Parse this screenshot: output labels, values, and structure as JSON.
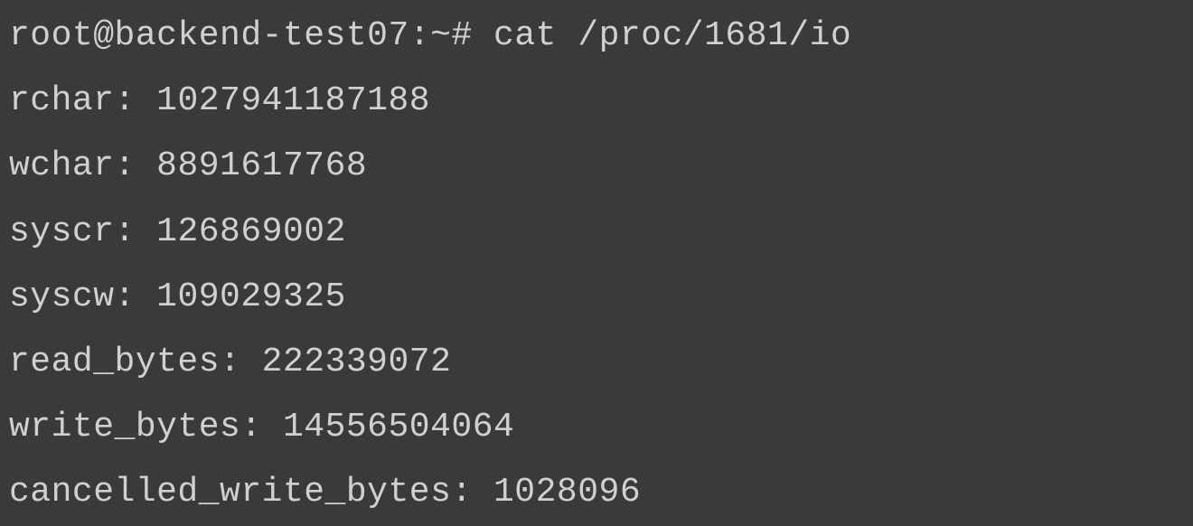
{
  "prompt": {
    "user": "root",
    "host": "backend-test07",
    "path": "~",
    "symbol": "#",
    "command": "cat /proc/1681/io"
  },
  "output": {
    "rchar": {
      "label": "rchar:",
      "value": "1027941187188"
    },
    "wchar": {
      "label": "wchar:",
      "value": "8891617768"
    },
    "syscr": {
      "label": "syscr:",
      "value": "126869002"
    },
    "syscw": {
      "label": "syscw:",
      "value": "109029325"
    },
    "read_bytes": {
      "label": "read_bytes:",
      "value": "222339072"
    },
    "write_bytes": {
      "label": "write_bytes:",
      "value": "14556504064"
    },
    "cancelled_write_bytes": {
      "label": "cancelled_write_bytes:",
      "value": "1028096"
    }
  }
}
